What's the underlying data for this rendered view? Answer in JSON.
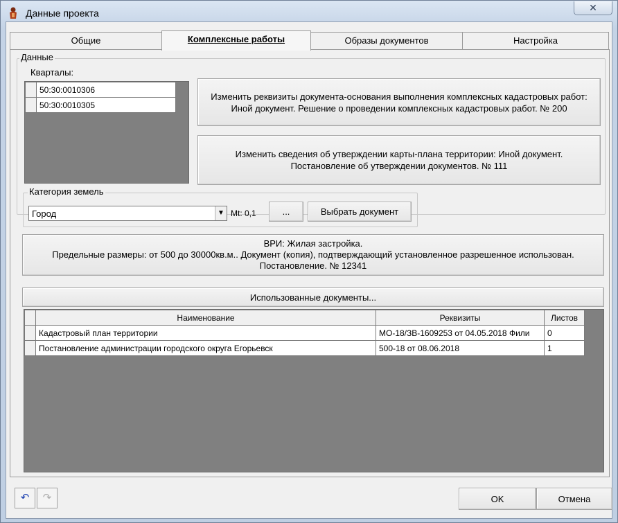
{
  "window": {
    "title": "Данные проекта",
    "close_glyph": "✕"
  },
  "tabs": [
    {
      "label": "Общие"
    },
    {
      "label": "Комплексные работы"
    },
    {
      "label": "Образы документов"
    },
    {
      "label": "Настройка"
    }
  ],
  "data_group": {
    "label": "Данные",
    "quarters_label": "Кварталы:",
    "quarters": [
      "50:30:0010306",
      "50:30:0010305"
    ]
  },
  "buttons": {
    "basis_doc": "Изменить реквизиты документа-основания выполнения комплексных кадастровых работ: Иной документ. Решение о проведении комплексных кадастровых работ. № 200",
    "map_plan": "Изменить сведения об утверждении карты-плана территории: Иной документ. Постановление об утверждении документов. № 111",
    "ellipsis": "...",
    "choose_doc": "Выбрать документ",
    "vri": "ВРИ: Жилая застройка.\nПредельные размеры: от 500 до 30000кв.м.. Документ (копия), подтверждающий установленное разрешенное использован.\nПостановление. № 12341",
    "used_docs": "Использованные документы...",
    "ok": "OK",
    "cancel": "Отмена"
  },
  "land_category": {
    "label": "Категория земель",
    "value": "Город",
    "mt_label": "Mt: 0,1"
  },
  "docs_table": {
    "columns": [
      "Наименование",
      "Реквизиты",
      "Листов"
    ],
    "rows": [
      [
        "Кадастровый план территории",
        "МО-18/ЗВ-1609253  от 04.05.2018 Фили",
        "0"
      ],
      [
        "Постановление администрации городского округа Егорьевск",
        "500-18  от 08.06.2018",
        "1"
      ]
    ]
  },
  "toolbar": {
    "undo_glyph": "↶",
    "redo_glyph": "↷"
  }
}
